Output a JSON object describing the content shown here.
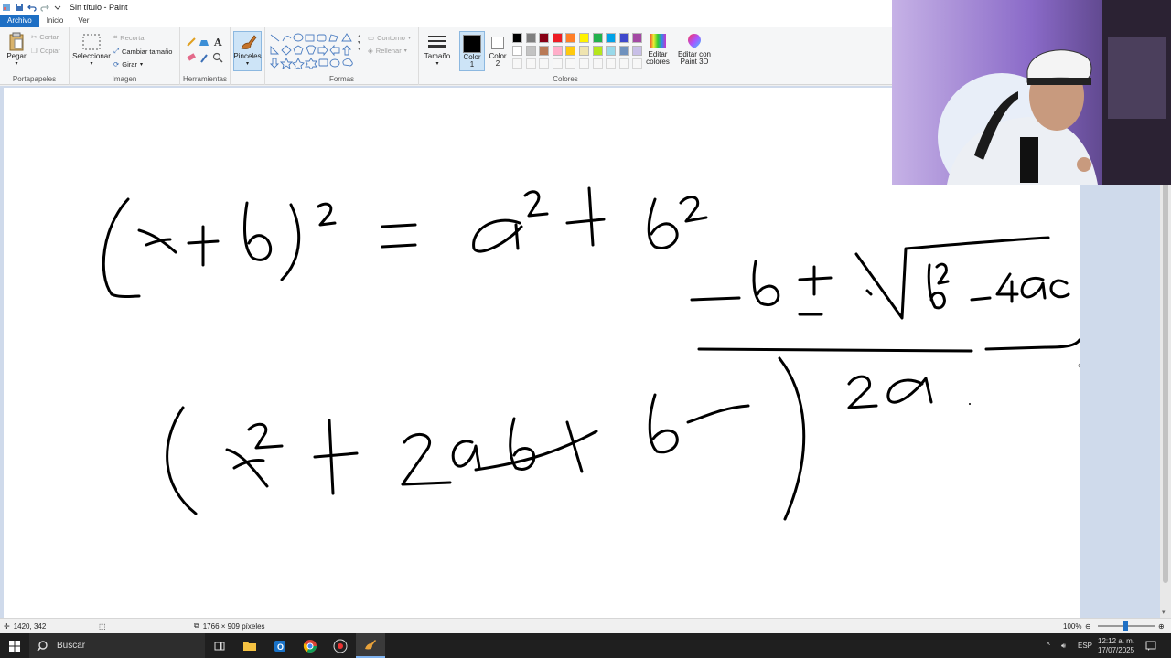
{
  "window": {
    "title": "Sin título - Paint"
  },
  "tabs": {
    "file": "Archivo",
    "home": "Inicio",
    "view": "Ver"
  },
  "ribbon": {
    "clipboard": {
      "label": "Portapapeles",
      "paste": "Pegar",
      "cut": "Cortar",
      "copy": "Copiar"
    },
    "image": {
      "label": "Imagen",
      "select": "Seleccionar",
      "crop": "Recortar",
      "resize": "Cambiar tamaño",
      "rotate": "Girar"
    },
    "tools": {
      "label": "Herramientas"
    },
    "brushes": {
      "label": "Pinceles"
    },
    "shapes": {
      "label": "Formas",
      "outline": "Contorno",
      "fill": "Rellenar"
    },
    "size": {
      "label": "Tamaño"
    },
    "colors": {
      "label": "Colores",
      "color1": "Color",
      "color1_num": "1",
      "color2": "Color",
      "color2_num": "2",
      "edit_colors": "Editar",
      "edit_colors_2": "colores",
      "paint3d": "Editar con",
      "paint3d_2": "Paint 3D",
      "row1": [
        "#000000",
        "#7f7f7f",
        "#880015",
        "#ed1c24",
        "#ff7f27",
        "#fff200",
        "#22b14c",
        "#00a2e8",
        "#3f48cc",
        "#a349a4"
      ],
      "row2": [
        "#ffffff",
        "#c3c3c3",
        "#b97a57",
        "#ffaec9",
        "#ffc90e",
        "#efe4b0",
        "#b5e61d",
        "#99d9ea",
        "#7092be",
        "#c8bfe7"
      ]
    }
  },
  "status": {
    "cursor_pos": "1420, 342",
    "canvas_size": "1766 × 909 píxeles",
    "zoom": "100%"
  },
  "taskbar": {
    "search_placeholder": "Buscar",
    "lang": "ESP",
    "time": "12:12 a. m.",
    "date": "17/07/2025"
  }
}
